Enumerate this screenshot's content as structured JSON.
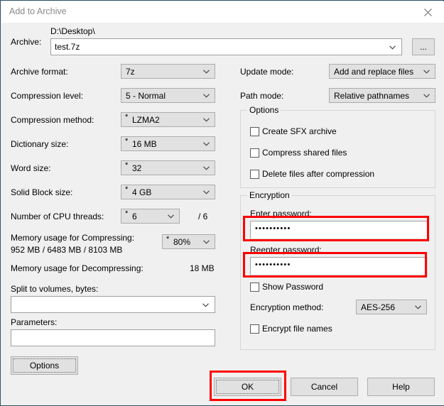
{
  "window": {
    "title": "Add to Archive",
    "close_icon": "close-icon"
  },
  "archive": {
    "label": "Archive:",
    "path": "D:\\Desktop\\",
    "filename": "test.7z",
    "browse_label": "..."
  },
  "left_fields": [
    {
      "label": "Archive format:",
      "value": "7z",
      "bullet": false
    },
    {
      "label": "Compression level:",
      "value": "5 - Normal",
      "bullet": false
    },
    {
      "label": "Compression method:",
      "value": "LZMA2",
      "bullet": true
    },
    {
      "label": "Dictionary size:",
      "value": "16 MB",
      "bullet": true
    },
    {
      "label": "Word size:",
      "value": "32",
      "bullet": true
    },
    {
      "label": "Solid Block size:",
      "value": "4 GB",
      "bullet": true
    }
  ],
  "cpu": {
    "label": "Number of CPU threads:",
    "value": "6",
    "bullet": true,
    "total": "/ 6"
  },
  "memory": {
    "compress_label": "Memory usage for Compressing:",
    "compress_values": "952 MB / 6483 MB / 8103 MB",
    "percent": "80%",
    "percent_bullet": true,
    "decompress_label": "Memory usage for Decompressing:",
    "decompress_value": "18 MB"
  },
  "split": {
    "label": "Split to volumes, bytes:",
    "value": ""
  },
  "parameters": {
    "label": "Parameters:",
    "value": ""
  },
  "options_button": {
    "label": "Options"
  },
  "update_mode": {
    "label": "Update mode:",
    "value": "Add and replace files"
  },
  "path_mode": {
    "label": "Path mode:",
    "value": "Relative pathnames"
  },
  "options_group": {
    "title": "Options",
    "checkboxes": [
      {
        "label": "Create SFX archive",
        "checked": false
      },
      {
        "label": "Compress shared files",
        "checked": false
      },
      {
        "label": "Delete files after compression",
        "checked": false
      }
    ]
  },
  "encryption": {
    "title": "Encryption",
    "enter_password_label": "Enter password:",
    "enter_password_value": "••••••••••",
    "reenter_password_label": "Reenter password:",
    "reenter_password_value": "••••••••••",
    "show_password": {
      "label": "Show Password",
      "checked": false
    },
    "method_label": "Encryption method:",
    "method_value": "AES-256",
    "encrypt_names": {
      "label": "Encrypt file names",
      "checked": false
    }
  },
  "footer": {
    "ok_label": "OK",
    "cancel_label": "Cancel",
    "help_label": "Help"
  },
  "annotations": {
    "highlight_color": "#ff0000",
    "boxes": [
      "enter-password-highlight",
      "reenter-password-highlight",
      "ok-button-highlight"
    ]
  }
}
